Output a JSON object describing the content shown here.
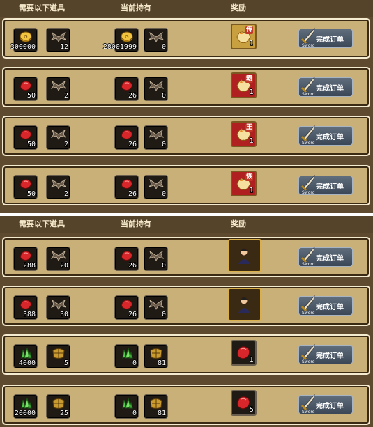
{
  "headers": {
    "required": "需要以下道具",
    "owned": "当前持有",
    "reward": "奖励"
  },
  "button_label": "完成订单",
  "button_brand": "Sword",
  "colors": {
    "panel": "#5e4a2e",
    "row": "#c8b078",
    "row_border": "#f4ebd0",
    "button": "#4a5666"
  },
  "top_rows": [
    {
      "req": [
        {
          "icon": "coin-icon",
          "qty": "300000"
        },
        {
          "icon": "bat-wing-icon",
          "qty": "12"
        }
      ],
      "own": [
        {
          "icon": "coin-icon",
          "qty": "28001999"
        },
        {
          "icon": "bat-wing-icon",
          "qty": "0"
        }
      ],
      "reward": {
        "icon": "fox-box-icon",
        "seal": "传",
        "qty": "1"
      }
    },
    {
      "req": [
        {
          "icon": "red-gem-icon",
          "qty": "50"
        },
        {
          "icon": "bat-wing-icon",
          "qty": "2"
        }
      ],
      "own": [
        {
          "icon": "red-gem-icon",
          "qty": "26"
        },
        {
          "icon": "bat-wing-icon",
          "qty": "0"
        }
      ],
      "reward": {
        "icon": "fox-box-icon",
        "seal": "霸",
        "qty": "1"
      }
    },
    {
      "req": [
        {
          "icon": "red-gem-icon",
          "qty": "50"
        },
        {
          "icon": "bat-wing-icon",
          "qty": "2"
        }
      ],
      "own": [
        {
          "icon": "red-gem-icon",
          "qty": "26"
        },
        {
          "icon": "bat-wing-icon",
          "qty": "0"
        }
      ],
      "reward": {
        "icon": "fox-box-icon",
        "seal": "王",
        "qty": "1"
      }
    },
    {
      "req": [
        {
          "icon": "red-gem-icon",
          "qty": "50"
        },
        {
          "icon": "bat-wing-icon",
          "qty": "2"
        }
      ],
      "own": [
        {
          "icon": "red-gem-icon",
          "qty": "26"
        },
        {
          "icon": "bat-wing-icon",
          "qty": "0"
        }
      ],
      "reward": {
        "icon": "fox-box-icon",
        "seal": "恢",
        "qty": "1"
      }
    }
  ],
  "bottom_rows": [
    {
      "req": [
        {
          "icon": "red-gem-icon",
          "qty": "288"
        },
        {
          "icon": "bat-wing-icon",
          "qty": "20"
        }
      ],
      "own": [
        {
          "icon": "red-gem-icon",
          "qty": "26"
        },
        {
          "icon": "bat-wing-icon",
          "qty": "0"
        }
      ],
      "reward": {
        "icon": "portrait-icon",
        "qty": ""
      }
    },
    {
      "req": [
        {
          "icon": "red-gem-icon",
          "qty": "388"
        },
        {
          "icon": "bat-wing-icon",
          "qty": "30"
        }
      ],
      "own": [
        {
          "icon": "red-gem-icon",
          "qty": "26"
        },
        {
          "icon": "bat-wing-icon",
          "qty": "0"
        }
      ],
      "reward": {
        "icon": "portrait-icon",
        "qty": ""
      }
    },
    {
      "req": [
        {
          "icon": "green-crystal-icon",
          "qty": "4000"
        },
        {
          "icon": "gold-armor-icon",
          "qty": "5"
        }
      ],
      "own": [
        {
          "icon": "green-crystal-icon",
          "qty": "0"
        },
        {
          "icon": "gold-armor-icon",
          "qty": "81"
        }
      ],
      "reward": {
        "icon": "red-gem-icon",
        "qty": "1"
      }
    },
    {
      "req": [
        {
          "icon": "green-crystal-icon",
          "qty": "20000"
        },
        {
          "icon": "gold-armor-icon",
          "qty": "25"
        }
      ],
      "own": [
        {
          "icon": "green-crystal-icon",
          "qty": "0"
        },
        {
          "icon": "gold-armor-icon",
          "qty": "81"
        }
      ],
      "reward": {
        "icon": "red-gem-icon",
        "qty": "5"
      }
    }
  ]
}
